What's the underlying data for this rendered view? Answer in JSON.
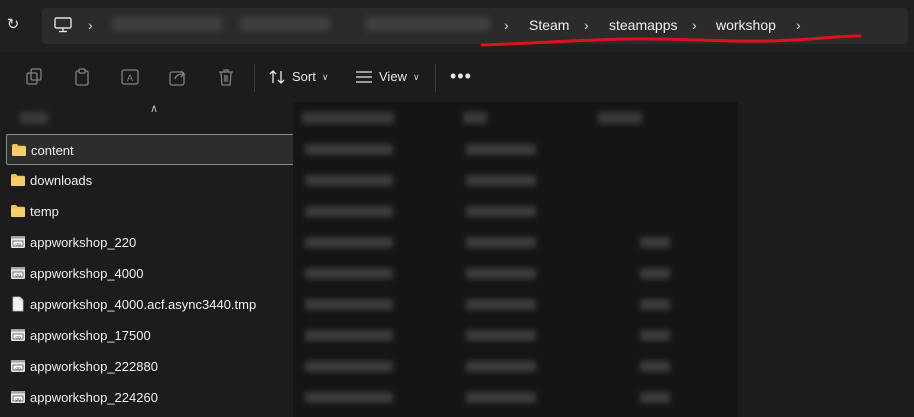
{
  "address_bar": {
    "breadcrumbs": [
      "Steam",
      "steamapps",
      "workshop"
    ]
  },
  "toolbar": {
    "sort_label": "Sort",
    "view_label": "View",
    "more_label": "•••"
  },
  "files": [
    {
      "name": "content",
      "type": "folder",
      "selected": true
    },
    {
      "name": "downloads",
      "type": "folder"
    },
    {
      "name": "temp",
      "type": "folder"
    },
    {
      "name": "appworkshop_220",
      "type": "acf"
    },
    {
      "name": "appworkshop_4000",
      "type": "acf"
    },
    {
      "name": "appworkshop_4000.acf.async3440.tmp",
      "type": "file"
    },
    {
      "name": "appworkshop_17500",
      "type": "acf"
    },
    {
      "name": "appworkshop_222880",
      "type": "acf"
    },
    {
      "name": "appworkshop_224260",
      "type": "acf"
    }
  ],
  "colors": {
    "annotation": "#e0101a",
    "folder": "#f2c14e",
    "background": "#1c1c1c"
  }
}
